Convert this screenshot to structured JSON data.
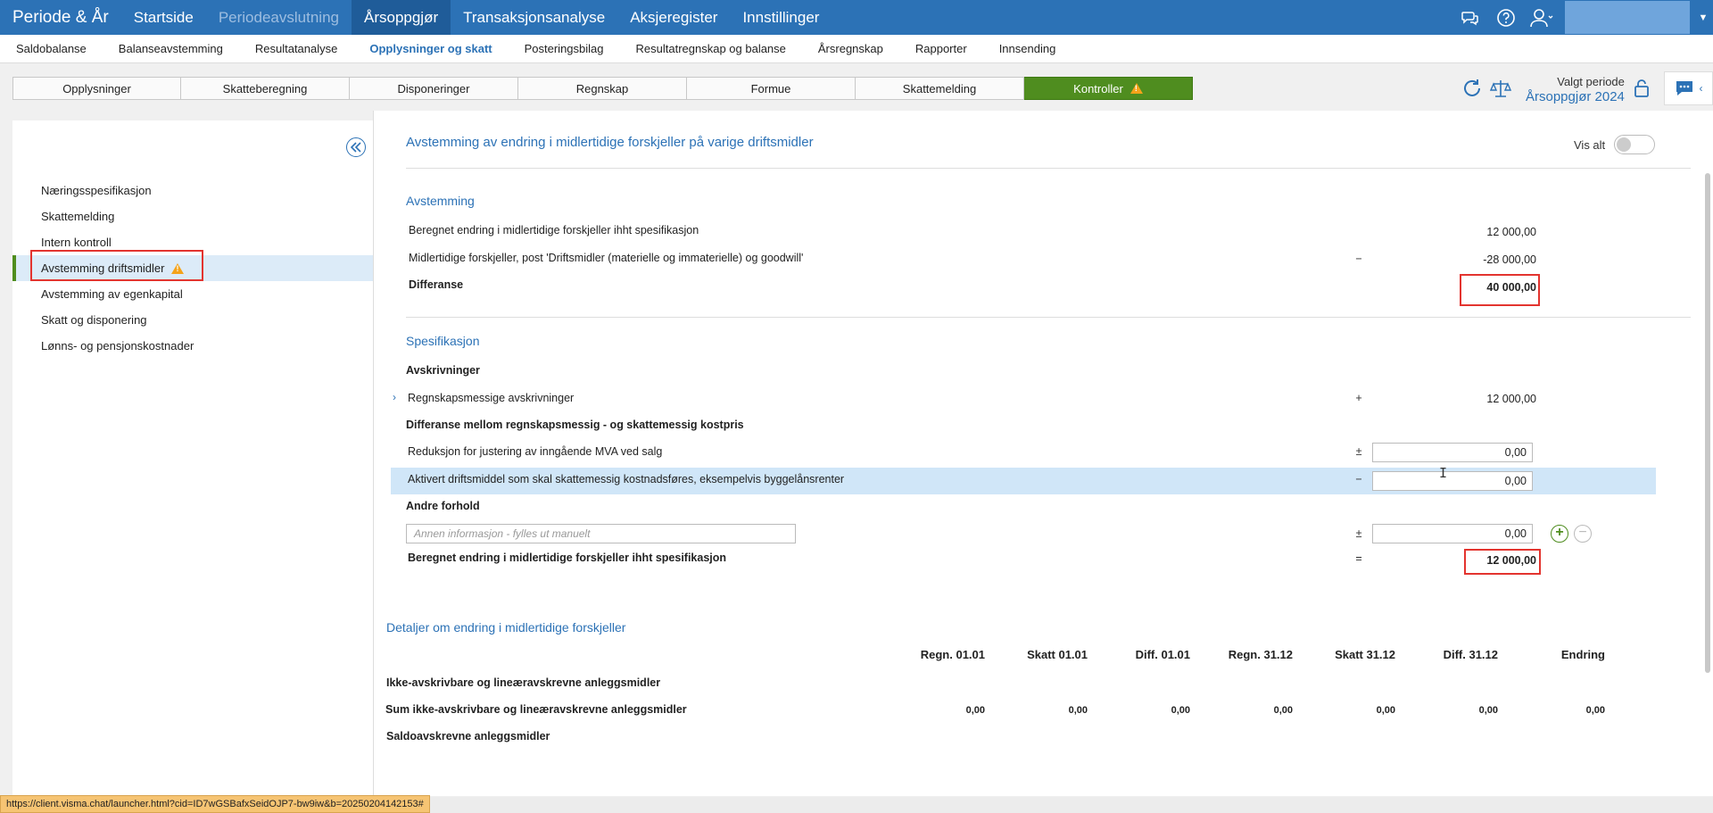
{
  "topnav": {
    "brand": "Periode & År",
    "items": [
      {
        "label": "Startside",
        "state": "normal"
      },
      {
        "label": "Periodeavslutning",
        "state": "disabled"
      },
      {
        "label": "Årsoppgjør",
        "state": "active"
      },
      {
        "label": "Transaksjonsanalyse",
        "state": "normal"
      },
      {
        "label": "Aksjeregister",
        "state": "normal"
      },
      {
        "label": "Innstillinger",
        "state": "normal"
      }
    ],
    "icons": [
      "chat-bubbles-icon",
      "help-icon",
      "user-icon"
    ]
  },
  "subnav": {
    "items": [
      {
        "label": "Saldobalanse",
        "active": false
      },
      {
        "label": "Balanseavstemming",
        "active": false
      },
      {
        "label": "Resultatanalyse",
        "active": false
      },
      {
        "label": "Opplysninger og skatt",
        "active": true
      },
      {
        "label": "Posteringsbilag",
        "active": false
      },
      {
        "label": "Resultatregnskap og balanse",
        "active": false
      },
      {
        "label": "Årsregnskap",
        "active": false
      },
      {
        "label": "Rapporter",
        "active": false
      },
      {
        "label": "Innsending",
        "active": false
      }
    ]
  },
  "tabs": [
    {
      "label": "Opplysninger",
      "active": false
    },
    {
      "label": "Skatteberegning",
      "active": false
    },
    {
      "label": "Disponeringer",
      "active": false
    },
    {
      "label": "Regnskap",
      "active": false
    },
    {
      "label": "Formue",
      "active": false
    },
    {
      "label": "Skattemelding",
      "active": false
    },
    {
      "label": "Kontroller",
      "active": true,
      "warning": true
    }
  ],
  "period": {
    "label": "Valgt periode",
    "value": "Årsoppgjør 2024"
  },
  "sidebar": {
    "items": [
      {
        "label": "Næringsspesifikasjon"
      },
      {
        "label": "Skattemelding"
      },
      {
        "label": "Intern kontroll"
      },
      {
        "label": "Avstemming driftsmidler",
        "active": true,
        "warning": true
      },
      {
        "label": "Avstemming av egenkapital"
      },
      {
        "label": "Skatt og disponering"
      },
      {
        "label": "Lønns- og pensjonskostnader"
      }
    ]
  },
  "main": {
    "title": "Avstemming av endring i midlertidige forskjeller på varige driftsmidler",
    "vis_alt": "Vis alt",
    "avstemming": {
      "title": "Avstemming",
      "rows": [
        {
          "label": "Beregnet endring i midlertidige forskjeller ihht spesifikasjon",
          "op": "",
          "value": "12 000,00"
        },
        {
          "label": "Midlertidige forskjeller, post 'Driftsmidler (materielle og immaterielle) og goodwill'",
          "op": "−",
          "value": "-28 000,00"
        },
        {
          "label": "Differanse",
          "op": "",
          "value": "40 000,00"
        }
      ]
    },
    "spesifikasjon": {
      "title": "Spesifikasjon",
      "avskrivninger_heading": "Avskrivninger",
      "regnskapsmessige": {
        "label": "Regnskapsmessige avskrivninger",
        "op": "+",
        "value": "12 000,00"
      },
      "diff_heading": "Differanse mellom regnskapsmessig - og skattemessig kostpris",
      "reduksjon": {
        "label": "Reduksjon for justering av inngående MVA ved salg",
        "op": "±",
        "value": "0,00"
      },
      "aktivert": {
        "label": "Aktivert driftsmiddel som skal skattemessig kostnadsføres, eksempelvis byggelånsrenter",
        "op": "−",
        "value": "0,00"
      },
      "andre_heading": "Andre forhold",
      "annen": {
        "placeholder": "Annen informasjon - fylles ut manuelt",
        "op": "±",
        "value": "0,00"
      },
      "beregnet": {
        "label": "Beregnet endring i midlertidige forskjeller ihht spesifikasjon",
        "op": "=",
        "value": "12 000,00"
      }
    },
    "detaljer": {
      "title": "Detaljer om endring i midlertidige forskjeller",
      "columns": [
        "Regn. 01.01",
        "Skatt 01.01",
        "Diff. 01.01",
        "Regn. 31.12",
        "Skatt 31.12",
        "Diff. 31.12",
        "Endring"
      ],
      "group1": "Ikke-avskrivbare og lineæravskrevne anleggsmidler",
      "sum1": {
        "label": "Sum ikke-avskrivbare og lineæravskrevne anleggsmidler",
        "values": [
          "0,00",
          "0,00",
          "0,00",
          "0,00",
          "0,00",
          "0,00",
          "0,00"
        ]
      },
      "group2": "Saldoavskrevne anleggsmidler"
    }
  },
  "statusbar": {
    "url": "https://client.visma.chat/launcher.html?cid=ID7wGSBafxSeidOJP7-bw9iw&b=20250204142153#"
  },
  "colors": {
    "primary": "#2c72b6",
    "accent_green": "#4f8d1f",
    "warning": "#f4a31a",
    "highlight": "#e3342f"
  }
}
